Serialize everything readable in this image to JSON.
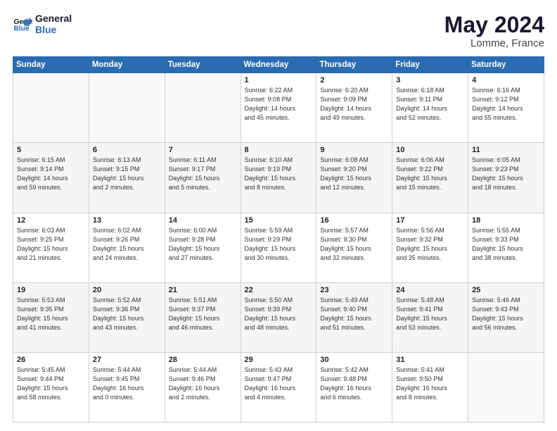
{
  "header": {
    "logo_text_general": "General",
    "logo_text_blue": "Blue",
    "month": "May 2024",
    "location": "Lomme, France"
  },
  "weekdays": [
    "Sunday",
    "Monday",
    "Tuesday",
    "Wednesday",
    "Thursday",
    "Friday",
    "Saturday"
  ],
  "weeks": [
    [
      {
        "day": "",
        "info": ""
      },
      {
        "day": "",
        "info": ""
      },
      {
        "day": "",
        "info": ""
      },
      {
        "day": "1",
        "info": "Sunrise: 6:22 AM\nSunset: 9:08 PM\nDaylight: 14 hours\nand 45 minutes."
      },
      {
        "day": "2",
        "info": "Sunrise: 6:20 AM\nSunset: 9:09 PM\nDaylight: 14 hours\nand 49 minutes."
      },
      {
        "day": "3",
        "info": "Sunrise: 6:18 AM\nSunset: 9:11 PM\nDaylight: 14 hours\nand 52 minutes."
      },
      {
        "day": "4",
        "info": "Sunrise: 6:16 AM\nSunset: 9:12 PM\nDaylight: 14 hours\nand 55 minutes."
      }
    ],
    [
      {
        "day": "5",
        "info": "Sunrise: 6:15 AM\nSunset: 9:14 PM\nDaylight: 14 hours\nand 59 minutes."
      },
      {
        "day": "6",
        "info": "Sunrise: 6:13 AM\nSunset: 9:15 PM\nDaylight: 15 hours\nand 2 minutes."
      },
      {
        "day": "7",
        "info": "Sunrise: 6:11 AM\nSunset: 9:17 PM\nDaylight: 15 hours\nand 5 minutes."
      },
      {
        "day": "8",
        "info": "Sunrise: 6:10 AM\nSunset: 9:19 PM\nDaylight: 15 hours\nand 8 minutes."
      },
      {
        "day": "9",
        "info": "Sunrise: 6:08 AM\nSunset: 9:20 PM\nDaylight: 15 hours\nand 12 minutes."
      },
      {
        "day": "10",
        "info": "Sunrise: 6:06 AM\nSunset: 9:22 PM\nDaylight: 15 hours\nand 15 minutes."
      },
      {
        "day": "11",
        "info": "Sunrise: 6:05 AM\nSunset: 9:23 PM\nDaylight: 15 hours\nand 18 minutes."
      }
    ],
    [
      {
        "day": "12",
        "info": "Sunrise: 6:03 AM\nSunset: 9:25 PM\nDaylight: 15 hours\nand 21 minutes."
      },
      {
        "day": "13",
        "info": "Sunrise: 6:02 AM\nSunset: 9:26 PM\nDaylight: 15 hours\nand 24 minutes."
      },
      {
        "day": "14",
        "info": "Sunrise: 6:00 AM\nSunset: 9:28 PM\nDaylight: 15 hours\nand 27 minutes."
      },
      {
        "day": "15",
        "info": "Sunrise: 5:59 AM\nSunset: 9:29 PM\nDaylight: 15 hours\nand 30 minutes."
      },
      {
        "day": "16",
        "info": "Sunrise: 5:57 AM\nSunset: 9:30 PM\nDaylight: 15 hours\nand 32 minutes."
      },
      {
        "day": "17",
        "info": "Sunrise: 5:56 AM\nSunset: 9:32 PM\nDaylight: 15 hours\nand 35 minutes."
      },
      {
        "day": "18",
        "info": "Sunrise: 5:55 AM\nSunset: 9:33 PM\nDaylight: 15 hours\nand 38 minutes."
      }
    ],
    [
      {
        "day": "19",
        "info": "Sunrise: 5:53 AM\nSunset: 9:35 PM\nDaylight: 15 hours\nand 41 minutes."
      },
      {
        "day": "20",
        "info": "Sunrise: 5:52 AM\nSunset: 9:36 PM\nDaylight: 15 hours\nand 43 minutes."
      },
      {
        "day": "21",
        "info": "Sunrise: 5:51 AM\nSunset: 9:37 PM\nDaylight: 15 hours\nand 46 minutes."
      },
      {
        "day": "22",
        "info": "Sunrise: 5:50 AM\nSunset: 9:39 PM\nDaylight: 15 hours\nand 48 minutes."
      },
      {
        "day": "23",
        "info": "Sunrise: 5:49 AM\nSunset: 9:40 PM\nDaylight: 15 hours\nand 51 minutes."
      },
      {
        "day": "24",
        "info": "Sunrise: 5:48 AM\nSunset: 9:41 PM\nDaylight: 15 hours\nand 53 minutes."
      },
      {
        "day": "25",
        "info": "Sunrise: 5:46 AM\nSunset: 9:43 PM\nDaylight: 15 hours\nand 56 minutes."
      }
    ],
    [
      {
        "day": "26",
        "info": "Sunrise: 5:45 AM\nSunset: 9:44 PM\nDaylight: 15 hours\nand 58 minutes."
      },
      {
        "day": "27",
        "info": "Sunrise: 5:44 AM\nSunset: 9:45 PM\nDaylight: 16 hours\nand 0 minutes."
      },
      {
        "day": "28",
        "info": "Sunrise: 5:44 AM\nSunset: 9:46 PM\nDaylight: 16 hours\nand 2 minutes."
      },
      {
        "day": "29",
        "info": "Sunrise: 5:43 AM\nSunset: 9:47 PM\nDaylight: 16 hours\nand 4 minutes."
      },
      {
        "day": "30",
        "info": "Sunrise: 5:42 AM\nSunset: 9:48 PM\nDaylight: 16 hours\nand 6 minutes."
      },
      {
        "day": "31",
        "info": "Sunrise: 5:41 AM\nSunset: 9:50 PM\nDaylight: 16 hours\nand 8 minutes."
      },
      {
        "day": "",
        "info": ""
      }
    ]
  ]
}
